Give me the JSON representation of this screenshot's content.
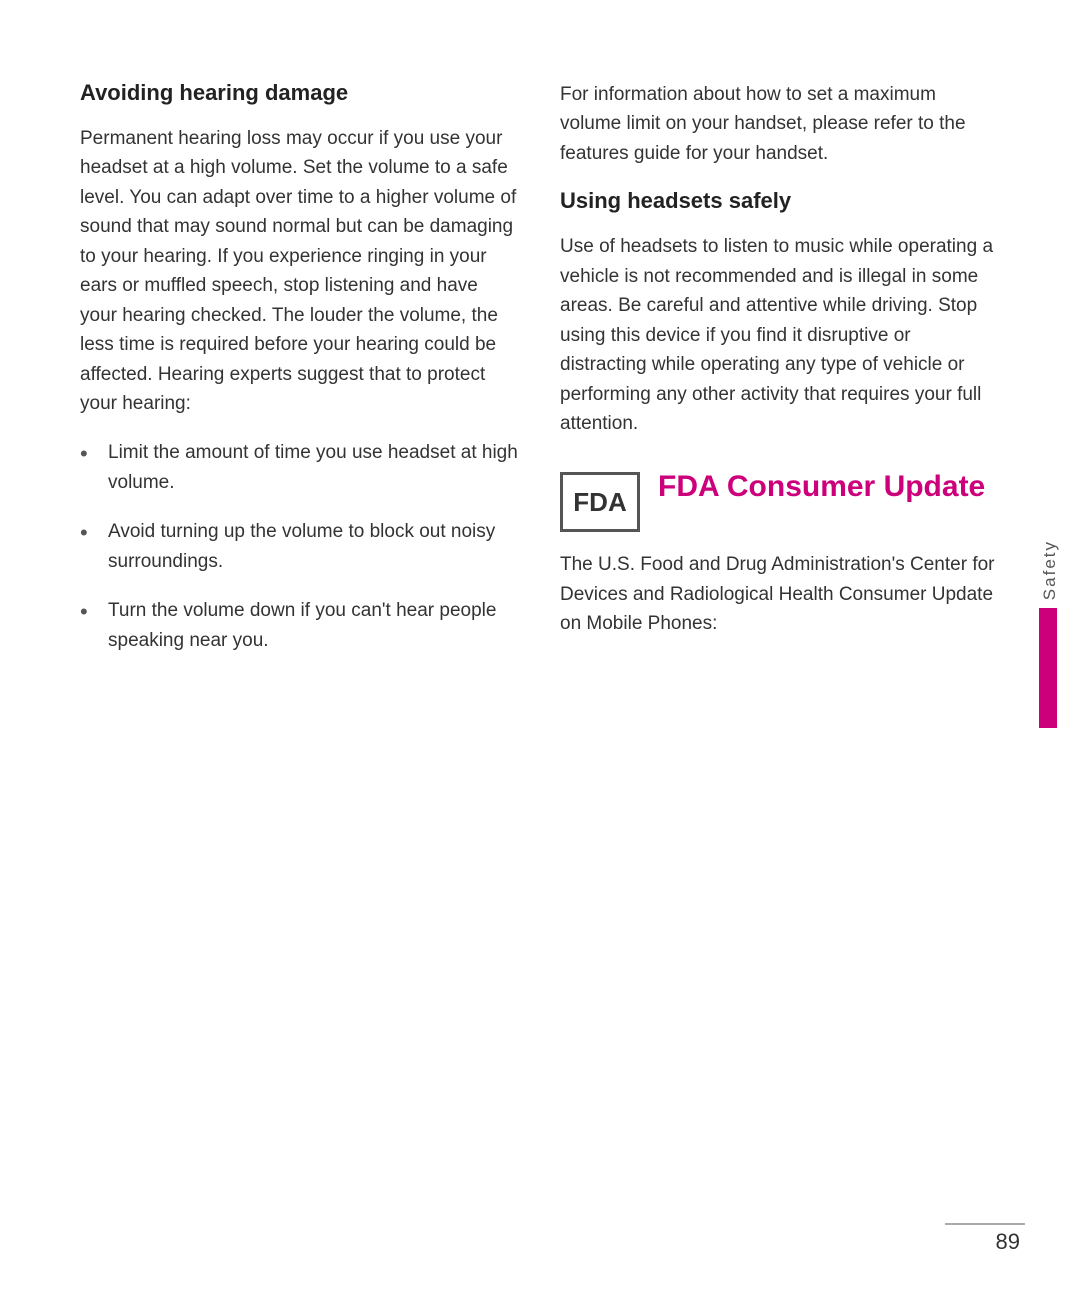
{
  "leftColumn": {
    "heading": "Avoiding hearing damage",
    "bodyText": "Permanent hearing loss may occur if you use your headset at a high volume. Set the volume to a safe level. You can adapt over time to a higher volume of sound that may sound normal but can be damaging to your hearing. If you experience ringing in your ears or muffled speech, stop listening and have your hearing checked. The louder the volume, the less time is required before your hearing could be affected. Hearing experts suggest that to protect your hearing:",
    "bullets": [
      "Limit the amount of time you use headset at high volume.",
      "Avoid turning up the volume to block out noisy surroundings.",
      "Turn the volume down if you can't hear people speaking near you."
    ]
  },
  "rightColumn": {
    "maxVolumeText": "For information about how to set a maximum volume limit on your handset, please refer to  the features guide for your handset.",
    "headsetHeading": "Using headsets safely",
    "headsetBody": "Use of headsets to listen to music while operating a vehicle is not recommended and is illegal in some areas. Be careful and attentive while driving.  Stop using this device if you find it disruptive or distracting while operating any type of vehicle or performing any other activity that requires your full attention.",
    "fdaLogoText": "FDA",
    "fdaTitle": "FDA Consumer Update",
    "fdaBodyText": "The U.S. Food and Drug Administration's Center for Devices and Radiological Health Consumer Update on Mobile Phones:"
  },
  "sidebar": {
    "label": "Safety"
  },
  "pageNumber": "89"
}
